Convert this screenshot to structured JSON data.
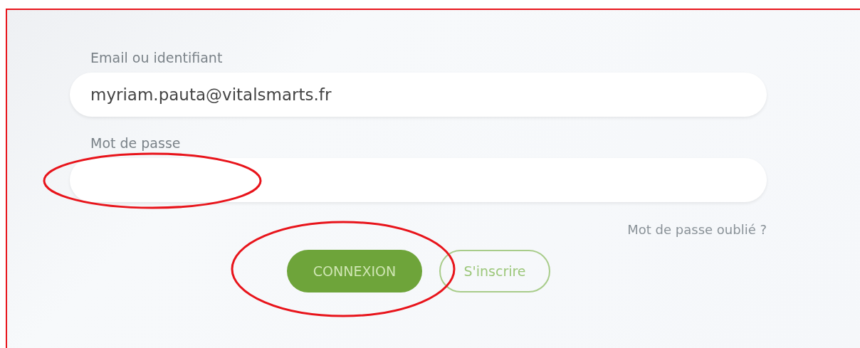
{
  "form": {
    "email": {
      "label": "Email ou identifiant",
      "value": "myriam.pauta@vitalsmarts.fr"
    },
    "password": {
      "label": "Mot de passe"
    },
    "forgot_link": "Mot de passe oublié ?",
    "buttons": [
      {
        "label": "CONNEXION",
        "kind": "primary"
      },
      {
        "label": "S'inscrire",
        "kind": "outline"
      }
    ]
  }
}
